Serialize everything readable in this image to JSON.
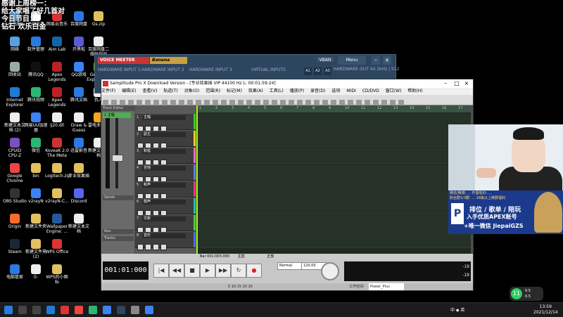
{
  "overlay": {
    "lines": [
      "感谢上周榜一：",
      "给大家唱了好几首对",
      "今日节目：",
      "钻石 欢乐白金"
    ]
  },
  "desktop_icons": [
    {
      "label": "此电脑",
      "color": "#5aa0e0"
    },
    {
      "label": "网络",
      "color": "#5aa0e0"
    },
    {
      "label": "回收站",
      "color": "#9aa"
    },
    {
      "label": "Internet Explorer",
      "color": "#1e7bd6"
    },
    {
      "label": "新建文本文档 (2)",
      "color": "#eee"
    },
    {
      "label": "CPUID CPU-Z",
      "color": "#7a4fbf"
    },
    {
      "label": "Google Chrome",
      "color": "#e44"
    },
    {
      "label": "OBS Studio",
      "color": "#333"
    },
    {
      "label": "Origin",
      "color": "#f56c2d"
    },
    {
      "label": "Steam",
      "color": "#1b2838"
    },
    {
      "label": "电脑管家",
      "color": "#2a7ae2"
    },
    {
      "label": "小幼无畏",
      "color": "#fff"
    },
    {
      "label": "软件管理",
      "color": "#2a7ae2"
    },
    {
      "label": "腾讯QQ",
      "color": "#111"
    },
    {
      "label": "腾讯视频",
      "color": "#2bb673"
    },
    {
      "label": "网易UU加速器",
      "color": "#3b82f6"
    },
    {
      "label": "微信",
      "color": "#2bb673"
    },
    {
      "label": "bin",
      "color": "#e0c060"
    },
    {
      "label": "v2rayN",
      "color": "#3b82f6"
    },
    {
      "label": "新建文件夹",
      "color": "#e0c060"
    },
    {
      "label": "新建文件夹 (2)",
      "color": "#e0c060"
    },
    {
      "label": "0-",
      "color": "#eee"
    },
    {
      "label": "网易云音乐",
      "color": "#d33"
    },
    {
      "label": "Aim Lab",
      "color": "#16a"
    },
    {
      "label": "Apex Legends",
      "color": "#b22"
    },
    {
      "label": "Apex Legends",
      "color": "#b22"
    },
    {
      "label": "ij20.dll",
      "color": "#eee"
    },
    {
      "label": "KoveaK 2.0 The Meta",
      "color": "#c33"
    },
    {
      "label": "Logitech.zip",
      "color": "#e0c060"
    },
    {
      "label": "v2rayN-C...",
      "color": "#e0c060"
    },
    {
      "label": "Wallpaper Engine: ...",
      "color": "#23599a"
    },
    {
      "label": "WPS Office",
      "color": "#d33"
    },
    {
      "label": "WPS的小图标",
      "color": "#e0c060"
    },
    {
      "label": "百度网盘",
      "color": "#2a7ae2"
    },
    {
      "label": "开黑啦",
      "color": "#5b5bd6"
    },
    {
      "label": "QQ游戏",
      "color": "#3b82f6"
    },
    {
      "label": "腾讯文档",
      "color": "#2a7ae2"
    },
    {
      "label": "Draw & Guess",
      "color": "#eee"
    },
    {
      "label": "迅雷影音",
      "color": "#2a7ae2"
    },
    {
      "label": "专业效果插",
      "color": "#e0c060"
    },
    {
      "label": "Discord",
      "color": "#5865f2"
    },
    {
      "label": "新建文本文档",
      "color": "#eee"
    },
    {
      "label": "Gs.zip",
      "color": "#e0c060"
    },
    {
      "label": "百度网盘二维码空间",
      "color": "#eee"
    },
    {
      "label": "GeForce Experience",
      "color": "#76b900"
    },
    {
      "label": "仇人",
      "color": "#eee"
    },
    {
      "label": "雷电多开器",
      "color": "#f5a623"
    },
    {
      "label": "新建文本文档",
      "color": "#eee"
    }
  ],
  "voicemeeter": {
    "logo": "VOICE MEETER",
    "logo2": "Banana",
    "sections": [
      "HARDWARE INPUT 1",
      "HARDWARE INPUT 2",
      "HARDWARE INPUT 3",
      "VIRTUAL INPUTS"
    ],
    "vban": "VBAN",
    "menu": "Menu",
    "buttons": [
      "A1",
      "A2",
      "A3",
      "B1"
    ],
    "hwout": "HARDWARE OUT 44.1kHz | 512"
  },
  "samplitude": {
    "title": "Samplitude Pro X Download Version - [专业效果插 VIP   44100 Hz L: 00:01:59:24]",
    "menu": [
      "文件(F)",
      "编辑(E)",
      "查看(V)",
      "轨道(T)",
      "对象(O)",
      "范围(R)",
      "标记(M)",
      "效果(A)",
      "工具(L)",
      "播放(P)",
      "录音(D)",
      "选项",
      "MIDI",
      "CD/DVD",
      "窗口(W)",
      "帮助(H)"
    ],
    "left_panel": {
      "header": "Track Editor",
      "track": "1 主唱",
      "sections": [
        "Sends",
        "Aux",
        "Tracks"
      ]
    },
    "tracks": [
      {
        "num": "1",
        "name": "主唱",
        "color": "#33cc33"
      },
      {
        "num": "2",
        "name": "副主",
        "color": "#eecc22"
      },
      {
        "num": "3",
        "name": "和弦",
        "color": "#ee66cc"
      },
      {
        "num": "4",
        "name": "吉他",
        "color": "#6677ee"
      },
      {
        "num": "5",
        "name": "和声",
        "color": "#ee3388"
      },
      {
        "num": "6",
        "name": "鼓声",
        "color": "#22bbbb"
      },
      {
        "num": "7",
        "name": "贝斯",
        "color": "#44cc44"
      },
      {
        "num": "8",
        "name": "音乐",
        "color": "#5566ee"
      }
    ],
    "ruler": [
      "1",
      "2",
      "3",
      "4",
      "5",
      "6",
      "7",
      "8",
      "9",
      "10",
      "11",
      "12",
      "13",
      "14",
      "15",
      "16",
      "17"
    ],
    "time": "001:01:000",
    "status_left": "Bar 001:003.000",
    "status_mid": "主直",
    "status_right": "正放",
    "tempo": "120.00",
    "mode": "Normal",
    "meter_l": "-18",
    "meter_r": "-18",
    "bottom_left": "5  10  15  20  25",
    "workspace_label": "工作空间:",
    "workspace": "Power_Plus"
  },
  "promo": {
    "line1": "微信/微博: ...    开黑啦ID: ...",
    "line2": "粉丝群1/3群: ...  16级以上微群福利",
    "logo": "P",
    "t1": "排位 / 歌单 / 陪玩",
    "t2": "入手优质APEX账号",
    "t3": "+唯一微信 JiepaiGZS"
  },
  "weather": {
    "badge": "11",
    "top": "0.5",
    "bottom": "0.5"
  },
  "taskbar": {
    "tray": "中 ◆ 英",
    "time": "13:59",
    "date": "2021/12/14"
  }
}
